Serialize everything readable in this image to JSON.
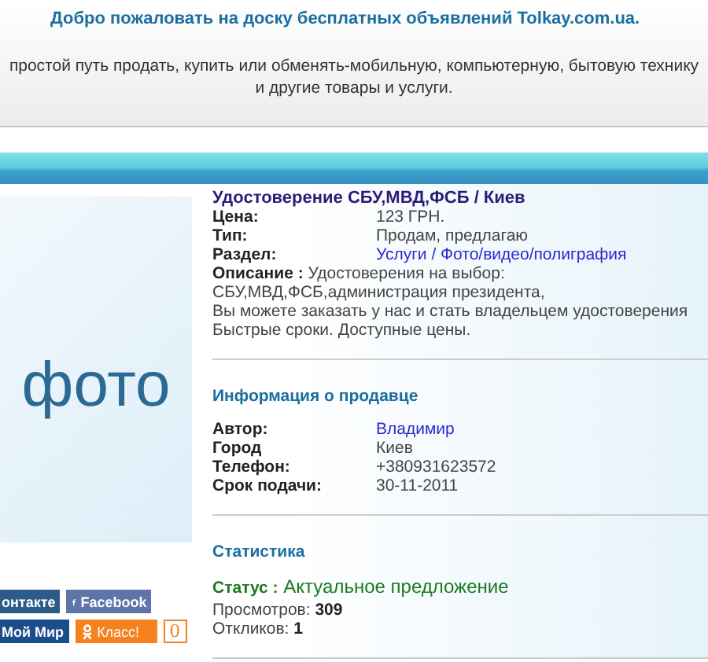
{
  "header": {
    "welcome": "Добро пожаловать на доску бесплатных объявлений Tolkay.com.ua.",
    "tagline": "простой путь продать, купить или обменять-мобильную, компьютерную, бытовую технику и другие товары и услуги."
  },
  "photo": {
    "placeholder": "фото"
  },
  "social": [
    {
      "label": "онтакте",
      "kind": "vk"
    },
    {
      "label": "Facebook",
      "kind": "facebook"
    },
    {
      "label": "Мой Мир",
      "kind": "mymir"
    },
    {
      "label": "Класс!",
      "kind": "ok",
      "count": "0"
    }
  ],
  "listing": {
    "title": "Удостоверение СБУ,МВД,ФСБ / Киев",
    "fields": [
      {
        "label": "Цена:",
        "value": "123 ГРН.",
        "kind": "text"
      },
      {
        "label": "Тип:",
        "value": "Продам, предлагаю",
        "kind": "text"
      },
      {
        "label": "Раздел:",
        "value": "Услуги / Фото/видео/полиграфия",
        "kind": "link"
      }
    ],
    "description": {
      "label": "Описание :",
      "lines": [
        "Удостоверения на выбор: СБУ,МВД,ФСБ,администрация президента,",
        "Вы можете заказать у нас и стать владельцем удостоверения",
        "Быстрые сроки. Доступные цены."
      ]
    }
  },
  "seller": {
    "heading": "Информация о продавце",
    "fields": [
      {
        "label": "Автор:",
        "value": "Владимир",
        "kind": "link"
      },
      {
        "label": "Город",
        "value": "Киев",
        "kind": "text"
      },
      {
        "label": "Телефон:",
        "value": "+380931623572",
        "kind": "text"
      },
      {
        "label": "Срок подачи:",
        "value": "30-11-2011",
        "kind": "text"
      }
    ]
  },
  "stats": {
    "heading": "Статистика",
    "status_label": "Статус :",
    "status_value": "Актуальное предложение",
    "counters": [
      {
        "label": "Просмотров:",
        "value": "309"
      },
      {
        "label": "Откликов:",
        "value": "1"
      }
    ]
  }
}
